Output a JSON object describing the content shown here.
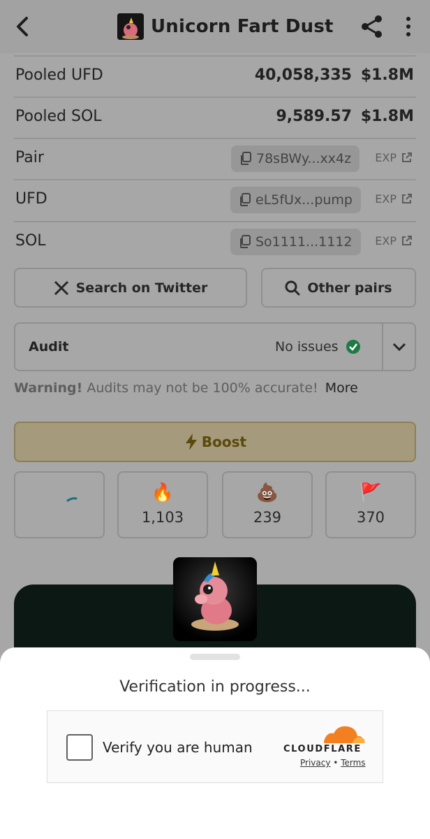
{
  "header": {
    "title": "Unicorn Fart Dust",
    "icons": [
      "chevron-left-icon",
      "share-icon",
      "more-vertical-icon"
    ]
  },
  "pooled": [
    {
      "label": "Pooled UFD",
      "amount": "40,058,335",
      "usd": "$1.8M"
    },
    {
      "label": "Pooled SOL",
      "amount": "9,589.57",
      "usd": "$1.8M"
    }
  ],
  "addresses": [
    {
      "label": "Pair",
      "address": "78sBWy...xx4z",
      "exp": "EXP"
    },
    {
      "label": "UFD",
      "address": "eL5fUx...pump",
      "exp": "EXP"
    },
    {
      "label": "SOL",
      "address": "So1111...1112",
      "exp": "EXP"
    }
  ],
  "actions": {
    "twitter": "Search on Twitter",
    "other_pairs": "Other pairs"
  },
  "audit": {
    "label": "Audit",
    "status": "No issues"
  },
  "warning": {
    "strong": "Warning!",
    "text": "Audits may not be 100% accurate!",
    "more": "More"
  },
  "boost": {
    "label": "Boost"
  },
  "reactions": [
    {
      "name": "rocket",
      "emoji": "",
      "count": ""
    },
    {
      "name": "fire",
      "emoji": "🔥",
      "count": "1,103"
    },
    {
      "name": "poop",
      "emoji": "💩",
      "count": "239"
    },
    {
      "name": "flag",
      "emoji": "🚩",
      "count": "370"
    }
  ],
  "verification": {
    "title": "Verification in progress...",
    "checkbox_label": "Verify you are human",
    "brand": "CLOUDFLARE",
    "privacy": "Privacy",
    "separator": "•",
    "terms": "Terms"
  },
  "colors": {
    "overlay_bg": "#a7a7a7",
    "boost_bg": "#a59a7c",
    "check_green": "#1e7a45",
    "cloudflare_orange": "#f38020"
  }
}
